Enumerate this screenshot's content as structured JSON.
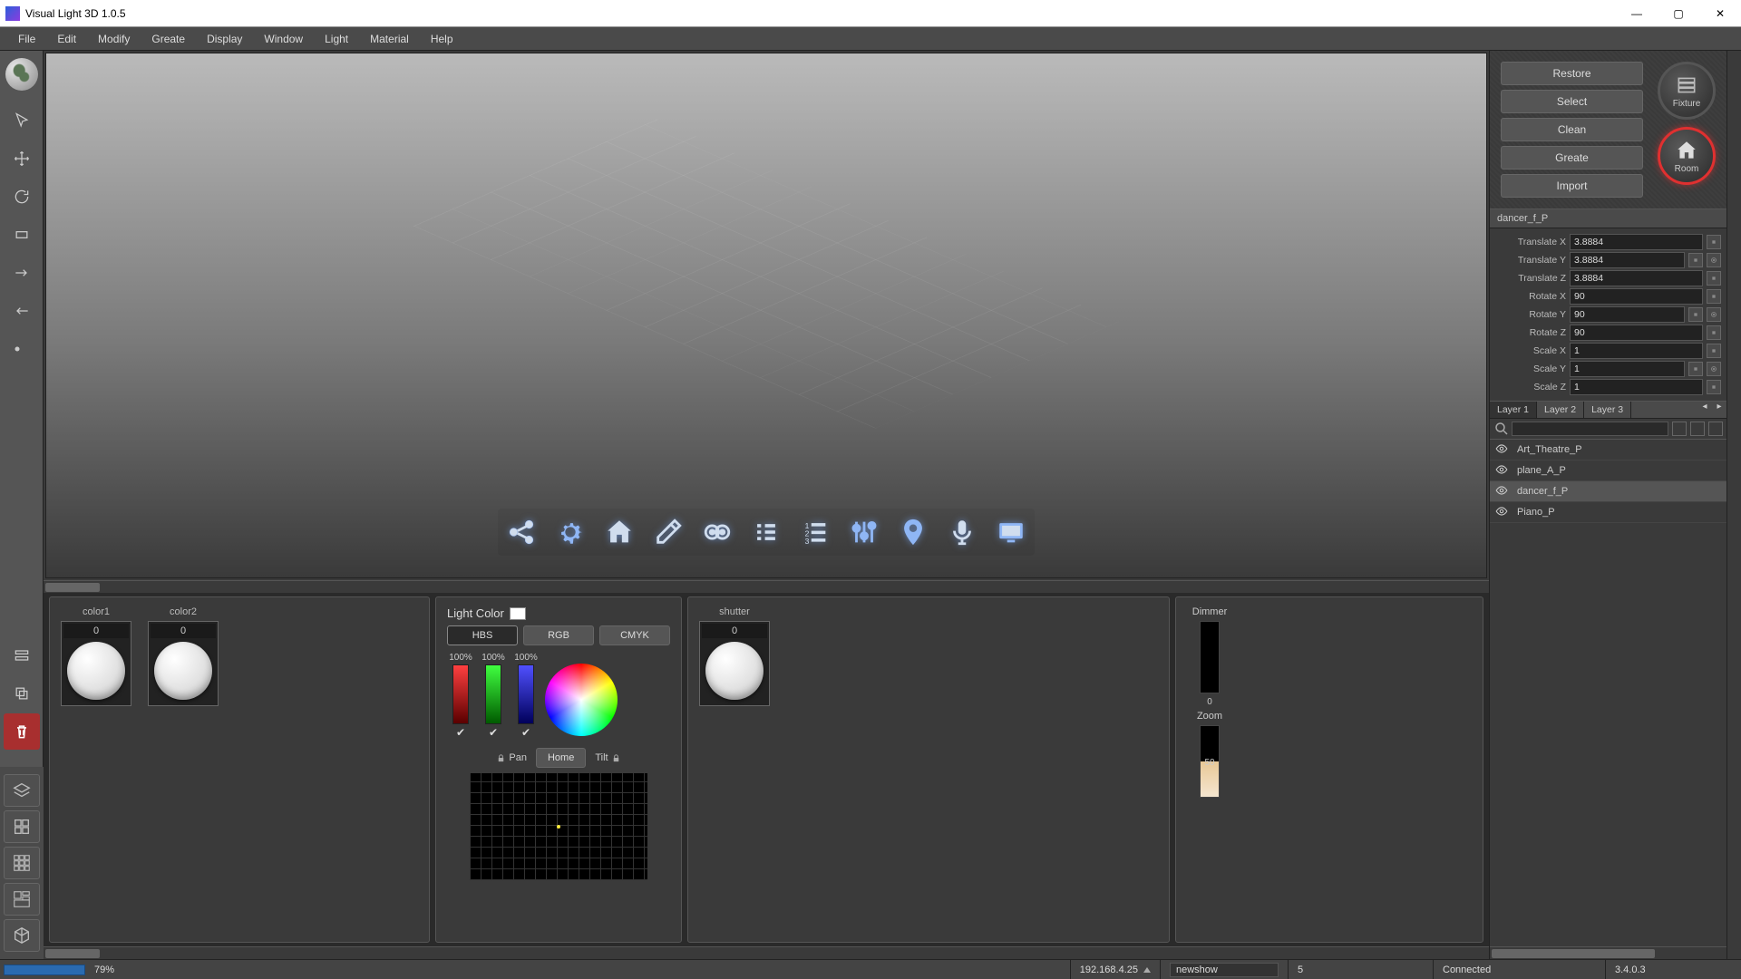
{
  "title": "Visual Light 3D 1.0.5",
  "menu": [
    "File",
    "Edit",
    "Modify",
    "Greate",
    "Display",
    "Window",
    "Light",
    "Material",
    "Help"
  ],
  "rightButtons": [
    "Restore",
    "Select",
    "Clean",
    "Greate",
    "Import"
  ],
  "rightIcons": {
    "fixture": "Fixture",
    "room": "Room"
  },
  "objName": "dancer_f_P",
  "props": [
    {
      "label": "Translate X",
      "val": "3.8884",
      "target": false
    },
    {
      "label": "Translate Y",
      "val": "3.8884",
      "target": true
    },
    {
      "label": "Translate Z",
      "val": "3.8884",
      "target": false
    },
    {
      "label": "Rotate X",
      "val": "90",
      "target": false
    },
    {
      "label": "Rotate Y",
      "val": "90",
      "target": true
    },
    {
      "label": "Rotate Z",
      "val": "90",
      "target": false
    },
    {
      "label": "Scale X",
      "val": "1",
      "target": false
    },
    {
      "label": "Scale Y",
      "val": "1",
      "target": true
    },
    {
      "label": "Scale Z",
      "val": "1",
      "target": false
    }
  ],
  "layers": [
    "Layer 1",
    "Layer 2",
    "Layer 3"
  ],
  "items": [
    {
      "name": "Art_Theatre_P",
      "sel": false
    },
    {
      "name": "plane_A_P",
      "sel": false
    },
    {
      "name": "dancer_f_P",
      "sel": true
    },
    {
      "name": "Piano_P",
      "sel": false
    }
  ],
  "colors": [
    {
      "label": "color1",
      "val": "0"
    },
    {
      "label": "color2",
      "val": "0"
    }
  ],
  "lightColor": {
    "title": "Light Color",
    "tabs": [
      "HBS",
      "RGB",
      "CMYK"
    ],
    "pct": "100%"
  },
  "pantilt": {
    "pan": "Pan",
    "home": "Home",
    "tilt": "Tilt"
  },
  "shutter": {
    "label": "shutter",
    "val": "0"
  },
  "dimmer": {
    "label": "Dimmer",
    "val": "0"
  },
  "zoom": {
    "label": "Zoom",
    "val": "50"
  },
  "status": {
    "pct": "79%",
    "ip": "192.168.4.25",
    "show": "newshow",
    "num": "5",
    "conn": "Connected",
    "ver": "3.4.0.3"
  }
}
